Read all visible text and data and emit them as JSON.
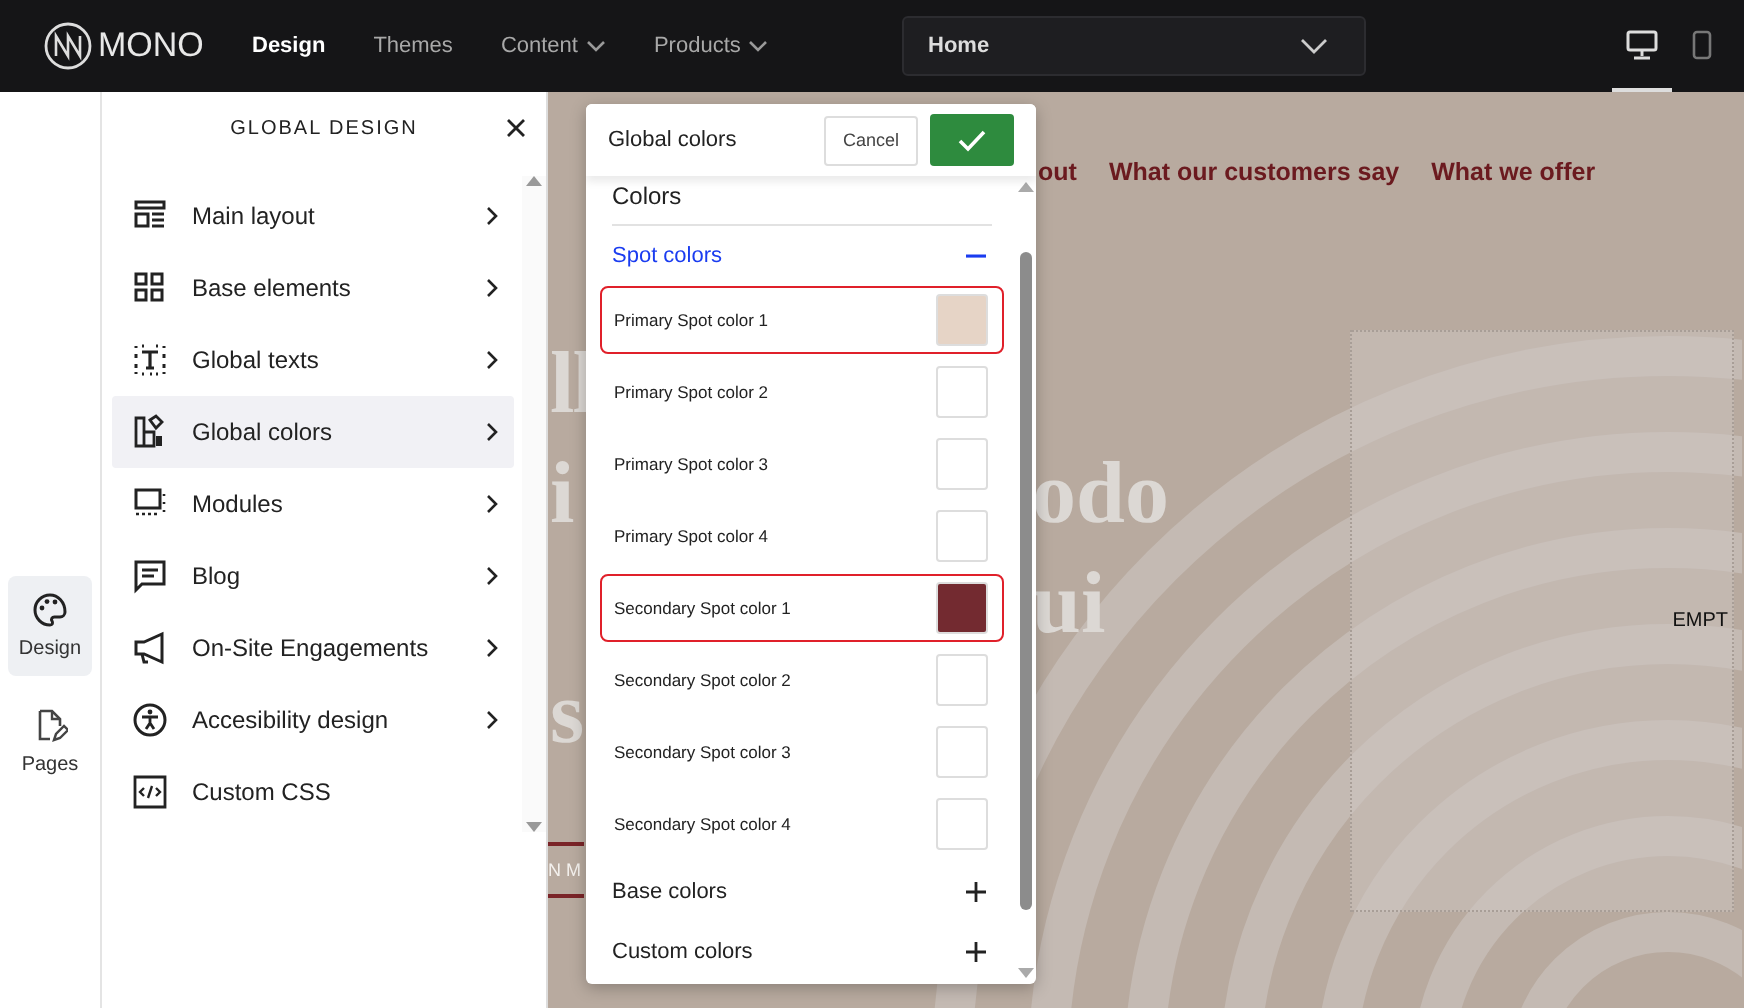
{
  "app_bar": {
    "logo_text": "MONO",
    "nav": [
      {
        "label": "Design",
        "selected": true,
        "has_menu": false
      },
      {
        "label": "Themes",
        "selected": false,
        "has_menu": false
      },
      {
        "label": "Content",
        "selected": false,
        "has_menu": true
      },
      {
        "label": "Products",
        "selected": false,
        "has_menu": true
      }
    ],
    "page_select": {
      "value": "Home"
    },
    "devices": [
      {
        "kind": "desktop",
        "selected": true
      },
      {
        "kind": "mobile",
        "selected": false
      }
    ]
  },
  "rail": [
    {
      "label": "Design",
      "selected": true
    },
    {
      "label": "Pages",
      "selected": false
    }
  ],
  "panel": {
    "title": "GLOBAL DESIGN",
    "items": [
      {
        "label": "Main layout",
        "has_submenu": true,
        "selected": false
      },
      {
        "label": "Base elements",
        "has_submenu": true,
        "selected": false
      },
      {
        "label": "Global texts",
        "has_submenu": true,
        "selected": false
      },
      {
        "label": "Global colors",
        "has_submenu": true,
        "selected": true
      },
      {
        "label": "Modules",
        "has_submenu": true,
        "selected": false
      },
      {
        "label": "Blog",
        "has_submenu": true,
        "selected": false
      },
      {
        "label": "On-Site Engagements",
        "has_submenu": true,
        "selected": false
      },
      {
        "label": "Accesibility design",
        "has_submenu": true,
        "selected": false
      },
      {
        "label": "Custom CSS",
        "has_submenu": false,
        "selected": false
      }
    ]
  },
  "preview": {
    "nav": [
      "out",
      "What our customers say",
      "What we offer"
    ],
    "hero_lines": [
      {
        "left": "ll"
      },
      {
        "left": "i",
        "right": "odo"
      },
      {
        "right": "ui"
      },
      {
        "left": "s"
      }
    ],
    "button_fragment": "N M",
    "empty_label": "EMPT"
  },
  "dialog": {
    "title": "Global colors",
    "cancel": "Cancel",
    "section": "Colors",
    "groups": [
      {
        "label": "Spot colors",
        "expanded": true,
        "items": [
          {
            "label": "Primary Spot color 1",
            "color": "#e6d4c6",
            "highlighted": true
          },
          {
            "label": "Primary Spot color 2",
            "color": "#ffffff",
            "highlighted": false
          },
          {
            "label": "Primary Spot color 3",
            "color": "#ffffff",
            "highlighted": false
          },
          {
            "label": "Primary Spot color 4",
            "color": "#ffffff",
            "highlighted": false
          },
          {
            "label": "Secondary Spot color 1",
            "color": "#732a30",
            "highlighted": true
          },
          {
            "label": "Secondary Spot color 2",
            "color": "#ffffff",
            "highlighted": false
          },
          {
            "label": "Secondary Spot color 3",
            "color": "#ffffff",
            "highlighted": false
          },
          {
            "label": "Secondary Spot color 4",
            "color": "#ffffff",
            "highlighted": false
          }
        ]
      },
      {
        "label": "Base colors",
        "expanded": false
      },
      {
        "label": "Custom colors",
        "expanded": false
      }
    ]
  }
}
